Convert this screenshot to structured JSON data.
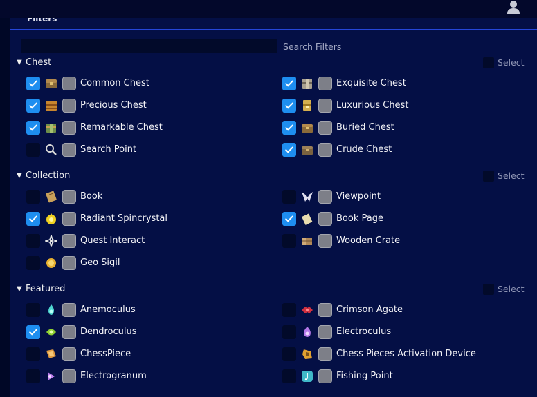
{
  "header": {
    "title": "Filters"
  },
  "search": {
    "label": "Search Filters"
  },
  "sections": [
    {
      "title": "Chest",
      "select_label": "Select",
      "items": [
        {
          "label": "Common Chest",
          "checked": true,
          "icon": "common-chest-icon",
          "color": "#8a6a3a"
        },
        {
          "label": "Exquisite Chest",
          "checked": true,
          "icon": "exquisite-chest-icon",
          "color": "#a8a090"
        },
        {
          "label": "Precious Chest",
          "checked": true,
          "icon": "precious-chest-icon",
          "color": "#c7852e"
        },
        {
          "label": "Luxurious Chest",
          "checked": true,
          "icon": "luxurious-chest-icon",
          "color": "#d6b04e"
        },
        {
          "label": "Remarkable Chest",
          "checked": true,
          "icon": "remarkable-chest-icon",
          "color": "#6e8f4a"
        },
        {
          "label": "Buried Chest",
          "checked": true,
          "icon": "buried-chest-icon",
          "color": "#8a6a3a"
        },
        {
          "label": "Search Point",
          "checked": false,
          "icon": "magnifier-icon",
          "color": "#d8d8d8"
        },
        {
          "label": "Crude Chest",
          "checked": true,
          "icon": "crude-chest-icon",
          "color": "#7a6240"
        }
      ]
    },
    {
      "title": "Collection",
      "select_label": "Select",
      "items": [
        {
          "label": "Book",
          "checked": false,
          "icon": "book-icon",
          "color": "#c8a05a"
        },
        {
          "label": "Viewpoint",
          "checked": false,
          "icon": "viewpoint-icon",
          "color": "#e0e0f0"
        },
        {
          "label": "Radiant Spincrystal",
          "checked": true,
          "icon": "spincrystal-icon",
          "color": "#f0d020"
        },
        {
          "label": "Book Page",
          "checked": true,
          "icon": "book-page-icon",
          "color": "#e8dcb0"
        },
        {
          "label": "Quest Interact",
          "checked": false,
          "icon": "quest-interact-icon",
          "color": "#e8e8e8"
        },
        {
          "label": "Wooden Crate",
          "checked": false,
          "icon": "wooden-crate-icon",
          "color": "#b08858"
        },
        {
          "label": "Geo Sigil",
          "checked": false,
          "icon": "geo-sigil-icon",
          "color": "#e8b030"
        }
      ]
    },
    {
      "title": "Featured",
      "select_label": "Select",
      "items": [
        {
          "label": "Anemoculus",
          "checked": false,
          "icon": "anemoculus-icon",
          "color": "#4ed6d0"
        },
        {
          "label": "Crimson Agate",
          "checked": false,
          "icon": "crimson-agate-icon",
          "color": "#d03040"
        },
        {
          "label": "Dendroculus",
          "checked": true,
          "icon": "dendroculus-icon",
          "color": "#8ed030"
        },
        {
          "label": "Electroculus",
          "checked": false,
          "icon": "electroculus-icon",
          "color": "#b478e8"
        },
        {
          "label": "ChessPiece",
          "checked": false,
          "icon": "chess-piece-icon",
          "color": "#e09a40"
        },
        {
          "label": "Chess Pieces Activation Device",
          "checked": false,
          "icon": "activation-device-icon",
          "color": "#e0a030"
        },
        {
          "label": "Electrogranum",
          "checked": false,
          "icon": "electrogranum-icon",
          "color": "#c080f0"
        },
        {
          "label": "Fishing Point",
          "checked": false,
          "icon": "fishing-point-icon",
          "color": "#40b8c8"
        }
      ]
    }
  ]
}
